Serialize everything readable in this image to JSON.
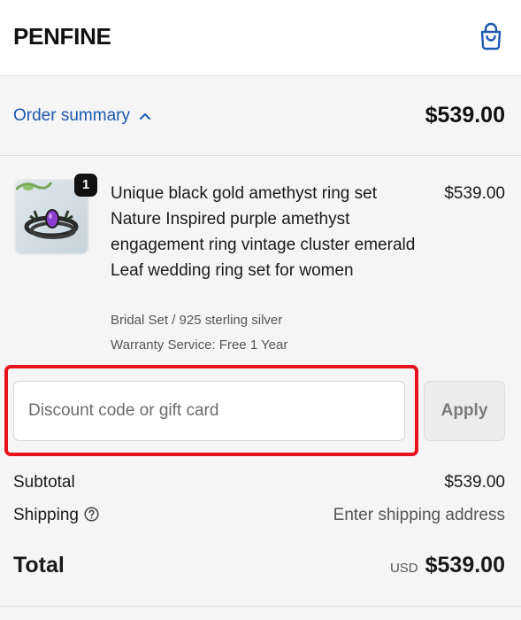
{
  "header": {
    "brand": "PENFINE",
    "cart_icon": "shopping-bag-icon"
  },
  "summary": {
    "toggle_label": "Order summary",
    "toggle_icon": "chevron-up-icon",
    "total": "$539.00"
  },
  "product": {
    "quantity": "1",
    "title": "Unique black gold amethyst ring set Nature Inspired purple amethyst engagement ring vintage cluster emerald Leaf wedding ring set for women",
    "price": "$539.00",
    "variant": "Bridal Set / 925 sterling silver",
    "warranty": "Warranty Service: Free 1 Year"
  },
  "discount": {
    "placeholder": "Discount code or gift card",
    "apply_label": "Apply"
  },
  "totals": {
    "subtotal_label": "Subtotal",
    "subtotal_value": "$539.00",
    "shipping_label": "Shipping",
    "shipping_icon": "help-circle-icon",
    "shipping_value": "Enter shipping address",
    "total_label": "Total",
    "currency": "USD",
    "total_value": "$539.00"
  },
  "colors": {
    "link": "#1c58b0",
    "highlight": "#e8131f",
    "background": "#f5f5f5"
  }
}
